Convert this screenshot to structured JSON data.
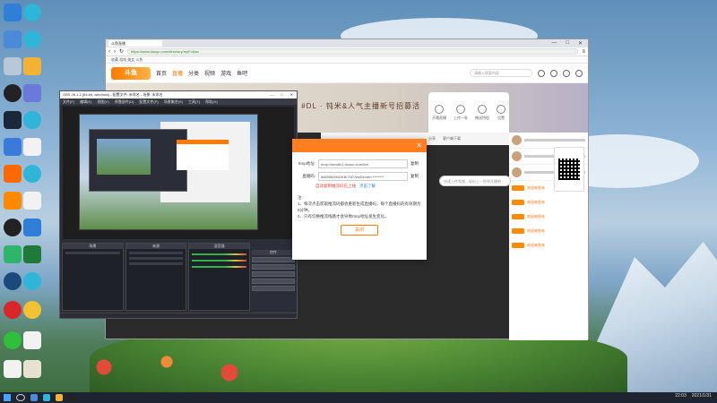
{
  "browser": {
    "tab_title": "斗鱼直播",
    "url": "https://www.douyu.com/directory/myFollow",
    "bookmarks_text": "收藏  游戏  美女  斗鱼",
    "window_controls": [
      "—",
      "□",
      "✕"
    ],
    "site": {
      "logo": "斗鱼",
      "nav": [
        "首页",
        "直播",
        "分类",
        "视频",
        "游戏",
        "鱼吧"
      ],
      "search_placeholder": "请输入搜索内容",
      "banner_text": "牵连礼包。  #DL · 钝米&人气主播新号招募活",
      "quick_actions": [
        "开播直播",
        "上传一条",
        "赠送特权",
        "设置"
      ],
      "mid_bar": [
        "分享",
        "客户端下载"
      ],
      "chat_labels": [
        "欢迎来到本",
        "欢迎来到本",
        "欢迎来到本",
        "欢迎来到本",
        "欢迎来到本"
      ],
      "tooltip": "快速上传视频，轻松上一秒钟开播吧"
    }
  },
  "obs": {
    "title": "OBS 26.1.2 (64-bit, windows) - 配置文件: 未命名 - 场景: 未命名",
    "menu": [
      "文件(F)",
      "编辑(E)",
      "视图(V)",
      "停靠部件(D)",
      "配置文件(P)",
      "场景集合(S)",
      "工具(T)",
      "帮助(H)"
    ],
    "docks": [
      "场景",
      "来源",
      "混音器",
      "控件"
    ]
  },
  "dialog": {
    "rtmp_label": "rtmp地址:",
    "rtmp_value": "rtmp://sendtc1.douyu.com/live",
    "key_label": "直播码:",
    "key_value": "5663989rNOKB/70D?wsSecret=********",
    "copy": "复制",
    "auto_notice": "自动复制推流码已上线",
    "learn_more": "点击了解",
    "note_title": "注:",
    "note_1": "1、每次点击获取推流码都会重新生成直播码，每个直播码的有效期为5分钟。",
    "note_2": "2、只有切换推流线路才会导致rtmp地址发生变化。",
    "close_button": "关闭"
  },
  "taskbar": {
    "time": "22:03",
    "date": "2021/1/31"
  }
}
